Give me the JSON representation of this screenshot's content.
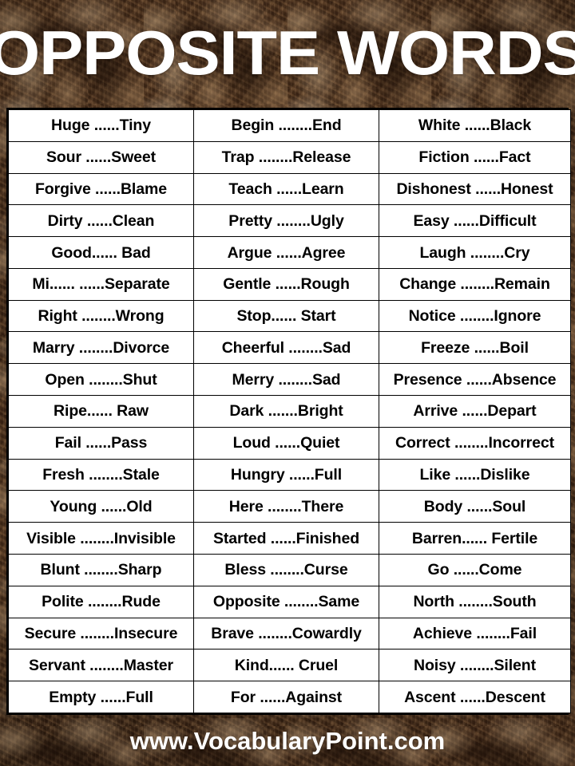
{
  "header": {
    "title": "OPPOSITE WORDS"
  },
  "footer": {
    "website": "www.VocabularyPoint.com"
  },
  "table": {
    "columns": 3,
    "rows": 19,
    "cells": [
      [
        "Huge ......Tiny",
        "Begin ........End",
        "White ......Black"
      ],
      [
        "Sour ......Sweet",
        "Trap ........Release",
        "Fiction ......Fact"
      ],
      [
        "Forgive ......Blame",
        "Teach ......Learn",
        "Dishonest ......Honest"
      ],
      [
        "Dirty ......Clean",
        "Pretty ........Ugly",
        "Easy ......Difficult"
      ],
      [
        "Good...... Bad",
        "Argue ......Agree",
        "Laugh ........Cry"
      ],
      [
        "Mi...... ......Separate",
        "Gentle ......Rough",
        "Change ........Remain"
      ],
      [
        "Right ........Wrong",
        "Stop...... Start",
        "Notice ........Ignore"
      ],
      [
        "Marry ........Divorce",
        "Cheerful ........Sad",
        "Freeze ......Boil"
      ],
      [
        "Open ........Shut",
        "Merry ........Sad",
        "Presence ......Absence"
      ],
      [
        "Ripe...... Raw",
        "Dark .......Bright",
        "Arrive ......Depart"
      ],
      [
        "Fail ......Pass",
        "Loud ......Quiet",
        "Correct ........Incorrect"
      ],
      [
        "Fresh ........Stale",
        "Hungry ......Full",
        "Like ......Dislike"
      ],
      [
        "Young ......Old",
        "Here ........There",
        "Body ......Soul"
      ],
      [
        "Visible ........Invisible",
        "Started ......Finished",
        "Barren...... Fertile"
      ],
      [
        "Blunt ........Sharp",
        "Bless ........Curse",
        "Go ......Come"
      ],
      [
        "Polite ........Rude",
        "Opposite ........Same",
        "North ........South"
      ],
      [
        "Secure ........Insecure",
        "Brave ........Cowardly",
        "Achieve ........Fail"
      ],
      [
        "Servant ........Master",
        "Kind...... Cruel",
        "Noisy ........Silent"
      ],
      [
        "Empty ......Full",
        "For ......Against",
        "Ascent ......Descent"
      ]
    ]
  },
  "colors": {
    "background_dark": "#3b2414",
    "background_mid": "#5a3a22",
    "background_light": "#c9aa84",
    "table_background": "#ffffff",
    "table_border": "#000000",
    "title_text": "#ffffff",
    "cell_text": "#000000"
  }
}
